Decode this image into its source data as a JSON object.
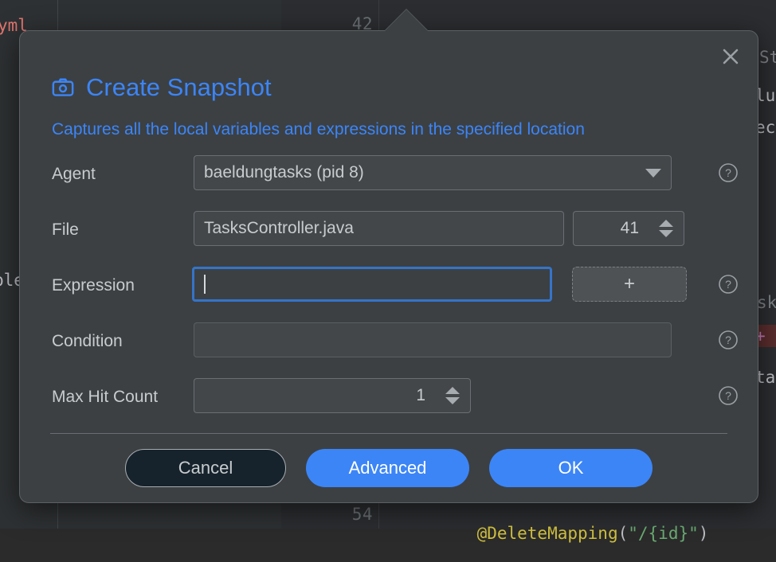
{
  "background": {
    "left_code_fragment": "ble",
    "yml_fragment": "yml",
    "line_numbers": [
      "42",
      "54"
    ],
    "code_line_54": {
      "annotation": "@DeleteMapping",
      "open_paren": "(",
      "string": "\"/{id}\"",
      "close_paren": ")"
    },
    "right_fragments": [
      "St",
      "lu",
      "ect",
      "sk",
      "ta"
    ],
    "right_highlight": "+"
  },
  "dialog": {
    "icon": "camera-icon",
    "title": "Create Snapshot",
    "subtitle": "Captures all the local variables and expressions in the specified location",
    "close_icon": "close-icon",
    "accent_color": "#3c85f7",
    "fields": {
      "agent": {
        "label": "Agent",
        "value": "baeldungtasks (pid 8)",
        "dropdown_icon": "chevron-down-icon",
        "help_icon": "help-icon"
      },
      "file": {
        "label": "File",
        "value": "TasksController.java",
        "line_number": "41",
        "stepper_icon": "stepper-arrows-icon"
      },
      "expression": {
        "label": "Expression",
        "value": "",
        "placeholder": "",
        "add_button_label": "+",
        "help_icon": "help-icon"
      },
      "condition": {
        "label": "Condition",
        "value": "",
        "placeholder": "",
        "help_icon": "help-icon"
      },
      "max_hit_count": {
        "label": "Max Hit Count",
        "value": "1",
        "stepper_icon": "stepper-arrows-icon",
        "help_icon": "help-icon"
      }
    },
    "buttons": {
      "cancel": "Cancel",
      "advanced": "Advanced",
      "ok": "OK"
    }
  }
}
